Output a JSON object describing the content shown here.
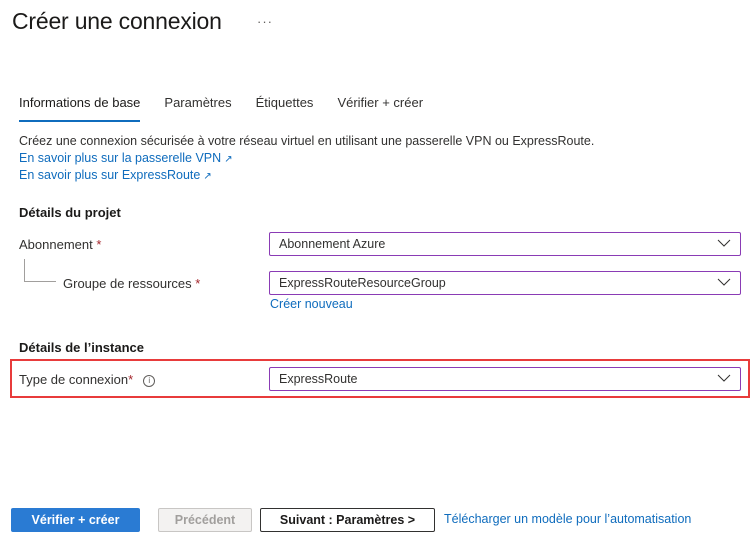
{
  "header": {
    "title": "Créer une connexion",
    "more_label": "···"
  },
  "tabs": [
    {
      "label": "Informations de base",
      "active": true
    },
    {
      "label": "Paramètres",
      "active": false
    },
    {
      "label": "Étiquettes",
      "active": false
    },
    {
      "label": "Vérifier + créer",
      "active": false
    }
  ],
  "intro": {
    "description": "Créez une connexion sécurisée à votre réseau virtuel en utilisant une passerelle VPN ou ExpressRoute.",
    "link_vpn": "En savoir plus sur la passerelle VPN",
    "link_expressroute": "En savoir plus sur ExpressRoute",
    "external_icon": "external-link-icon"
  },
  "project": {
    "heading": "Détails du projet",
    "subscription": {
      "label": "Abonnement",
      "required_mark": "*",
      "value": "Abonnement Azure"
    },
    "resource_group": {
      "label": "Groupe de ressources",
      "required_mark": "*",
      "value": "ExpressRouteResourceGroup",
      "create_new": "Créer nouveau"
    }
  },
  "instance": {
    "heading": "Détails de l’instance",
    "connection_type": {
      "label": "Type de connexion",
      "required_mark": "*",
      "info_icon": "i",
      "value": "ExpressRoute"
    }
  },
  "footer": {
    "review_create": "Vérifier + créer",
    "previous": "Précédent",
    "next": "Suivant : Paramètres >",
    "download_template": "Télécharger un modèle pour l’automatisation"
  },
  "colors": {
    "accent": "#0f6cbd",
    "primary_button": "#2a7bd3",
    "select_border": "#8a3bb5",
    "highlight_border": "#e83b3b",
    "required": "#a4262c"
  }
}
